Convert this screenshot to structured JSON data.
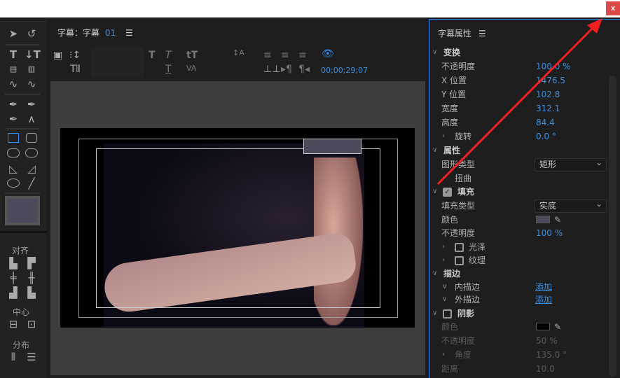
{
  "window": {
    "close_label": "x"
  },
  "tools": {
    "align_label": "对齐",
    "center_label": "中心",
    "distribute_label": "分布"
  },
  "main": {
    "title": "字幕：字幕",
    "title_num": "01",
    "menu_icon": "hamburger-icon",
    "timecode": "00;00;29;07"
  },
  "props": {
    "title": "字幕属性",
    "transform": {
      "label": "变换",
      "opacity_label": "不透明度",
      "opacity": "100.0 %",
      "x_label": "X 位置",
      "x": "1476.5",
      "y_label": "Y 位置",
      "y": "102.8",
      "width_label": "宽度",
      "width": "312.1",
      "height_label": "高度",
      "height": "84.4",
      "rotation_label": "旋转",
      "rotation": "0.0 °"
    },
    "attributes": {
      "label": "属性",
      "shape_label": "图形类型",
      "shape": "矩形",
      "distort_label": "扭曲"
    },
    "fill": {
      "label": "填充",
      "checked": true,
      "type_label": "填充类型",
      "type": "实底",
      "color_label": "颜色",
      "color": "#4d4a5c",
      "opacity_label": "不透明度",
      "opacity": "100 %",
      "sheen_label": "光泽",
      "texture_label": "纹理"
    },
    "stroke": {
      "label": "描边",
      "inner_label": "内描边",
      "inner_action": "添加",
      "outer_label": "外描边",
      "outer_action": "添加"
    },
    "shadow": {
      "label": "阴影",
      "checked": false,
      "color_label": "颜色",
      "color": "#000000",
      "opacity_label": "不透明度",
      "opacity": "50 %",
      "angle_label": "角度",
      "angle": "135.0 °",
      "distance_label": "距离",
      "distance": "10.0"
    }
  },
  "annotation": {
    "arrow_color": "#f02020"
  }
}
